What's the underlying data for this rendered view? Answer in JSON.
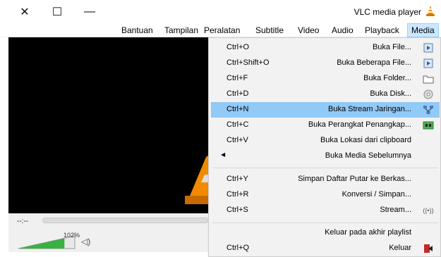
{
  "window": {
    "title": "VLC media player",
    "controls": {
      "close": "✕",
      "maximize": "☐",
      "minimize": "—"
    }
  },
  "menubar": {
    "items": [
      "Media",
      "Playback",
      "Audio",
      "Video",
      "Subtitle",
      "Peralatan",
      "Tampilan",
      "Bantuan"
    ]
  },
  "player": {
    "time": "--:--",
    "volume": "102%",
    "volume_level": 1.02
  },
  "media_menu": {
    "items": [
      {
        "label": "Buka File...",
        "shortcut": "Ctrl+O",
        "icon": "file-play-icon"
      },
      {
        "label": "Buka Beberapa File...",
        "shortcut": "Ctrl+Shift+O",
        "icon": "files-play-icon"
      },
      {
        "label": "Buka Folder...",
        "shortcut": "Ctrl+F",
        "icon": "folder-icon"
      },
      {
        "label": "Buka Disk...",
        "shortcut": "Ctrl+D",
        "icon": "disc-icon"
      },
      {
        "label": "Buka Stream Jaringan...",
        "shortcut": "Ctrl+N",
        "icon": "network-icon",
        "highlighted": true
      },
      {
        "label": "Buka Perangkat Penangkap...",
        "shortcut": "Ctrl+C",
        "icon": "capture-card-icon"
      },
      {
        "label": "Buka Lokasi dari clipboard",
        "shortcut": "Ctrl+V",
        "icon": ""
      },
      {
        "label": "Buka Media Sebelumnya",
        "shortcut": "",
        "icon": "",
        "submenu": true
      },
      {
        "label": "Simpan Daftar Putar ke Berkas...",
        "shortcut": "Ctrl+Y",
        "icon": ""
      },
      {
        "label": "Konversi / Simpan...",
        "shortcut": "Ctrl+R",
        "icon": ""
      },
      {
        "label": "Stream...",
        "shortcut": "Ctrl+S",
        "icon": "stream-icon"
      },
      {
        "label": "Keluar pada akhir playlist",
        "shortcut": "",
        "icon": ""
      },
      {
        "label": "Keluar",
        "shortcut": "Ctrl+Q",
        "icon": "exit-icon"
      }
    ]
  }
}
